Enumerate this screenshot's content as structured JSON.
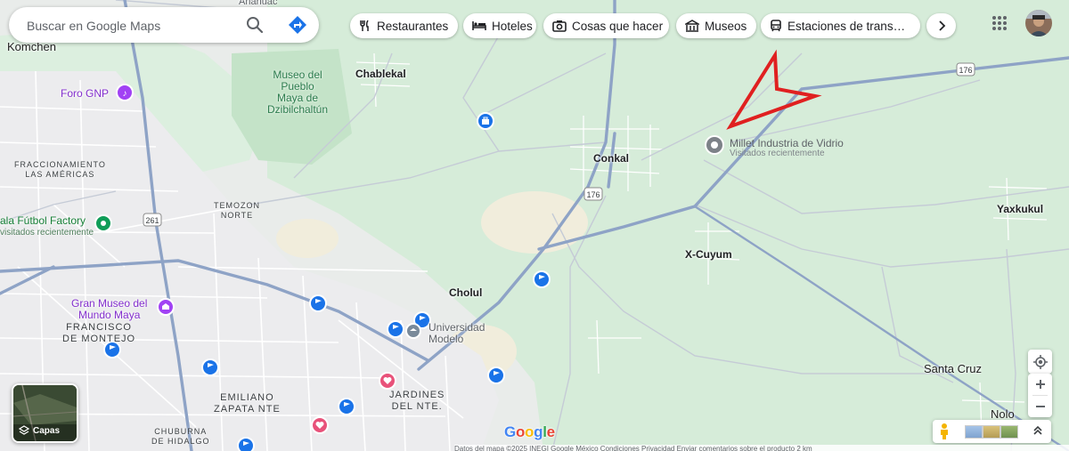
{
  "search": {
    "placeholder": "Buscar en Google Maps"
  },
  "chips": [
    {
      "label": "Restaurantes",
      "icon": "fork-knife-icon"
    },
    {
      "label": "Hoteles",
      "icon": "bed-icon"
    },
    {
      "label": "Cosas que hacer",
      "icon": "camera-icon"
    },
    {
      "label": "Museos",
      "icon": "museum-icon"
    },
    {
      "label": "Estaciones de trans…",
      "icon": "train-icon"
    }
  ],
  "places": {
    "komchen": "Komchen",
    "chablekal": "Chablekal",
    "anahuac": "Anáhuac",
    "museo_pueblo_maya": "Museo del\nPueblo\nMaya de\nDzibilchaltún",
    "foro_gnp": "Foro GNP",
    "fracc_americas": "FRACCIONAMIENTO\nLAS AMÉRICAS",
    "temozon_norte": "TEMOZON\nNORTE",
    "futbol_factory": "ala Fútbol Factory",
    "futbol_factory_sub": "visitados recientemente",
    "conkal": "Conkal",
    "x_cuyum": "X-Cuyum",
    "yaxkukul": "Yaxkukul",
    "cholul": "Cholul",
    "universidad_modelo": "Universidad\nModelo",
    "gran_museo": "Gran Museo del\nMundo Maya",
    "francisco_montejo": "FRANCISCO\nDE MONTEJO",
    "emiliano_zapata": "EMILIANO\nZAPATA NTE",
    "jardines_del_nte": "JARDINES\nDEL NTE.",
    "chuburna": "CHUBURNA\nDE HIDALGO",
    "santa_cruz": "Santa Cruz",
    "nolo": "Nolo"
  },
  "highways": [
    "176",
    "176",
    "261"
  ],
  "marked_place": {
    "name": "Millet Industria de Vidrio",
    "subtitle": "Visitados recientemente"
  },
  "layers_button": {
    "label": "Capas"
  },
  "attribution": "Datos del mapa ©2025 INEGI   Google   México   Condiciones   Privacidad   Enviar comentarios sobre el producto   2 km",
  "brand": {
    "letters": [
      "G",
      "o",
      "o",
      "g",
      "l",
      "e"
    ],
    "colors": [
      "#4285f4",
      "#ea4335",
      "#fbbc05",
      "#4285f4",
      "#34a853",
      "#ea4335"
    ]
  },
  "colors": {
    "highway": "#8ea3c6",
    "street": "#ffffff",
    "park": "#cfe8cf",
    "urban": "#e8e8e8",
    "annotation_arrow": "#e02020",
    "transit_pin": "#1a73e8",
    "saved_pin": "#e8527a",
    "museum_purple": "#8430ce",
    "place_green": "#0f9d58"
  }
}
